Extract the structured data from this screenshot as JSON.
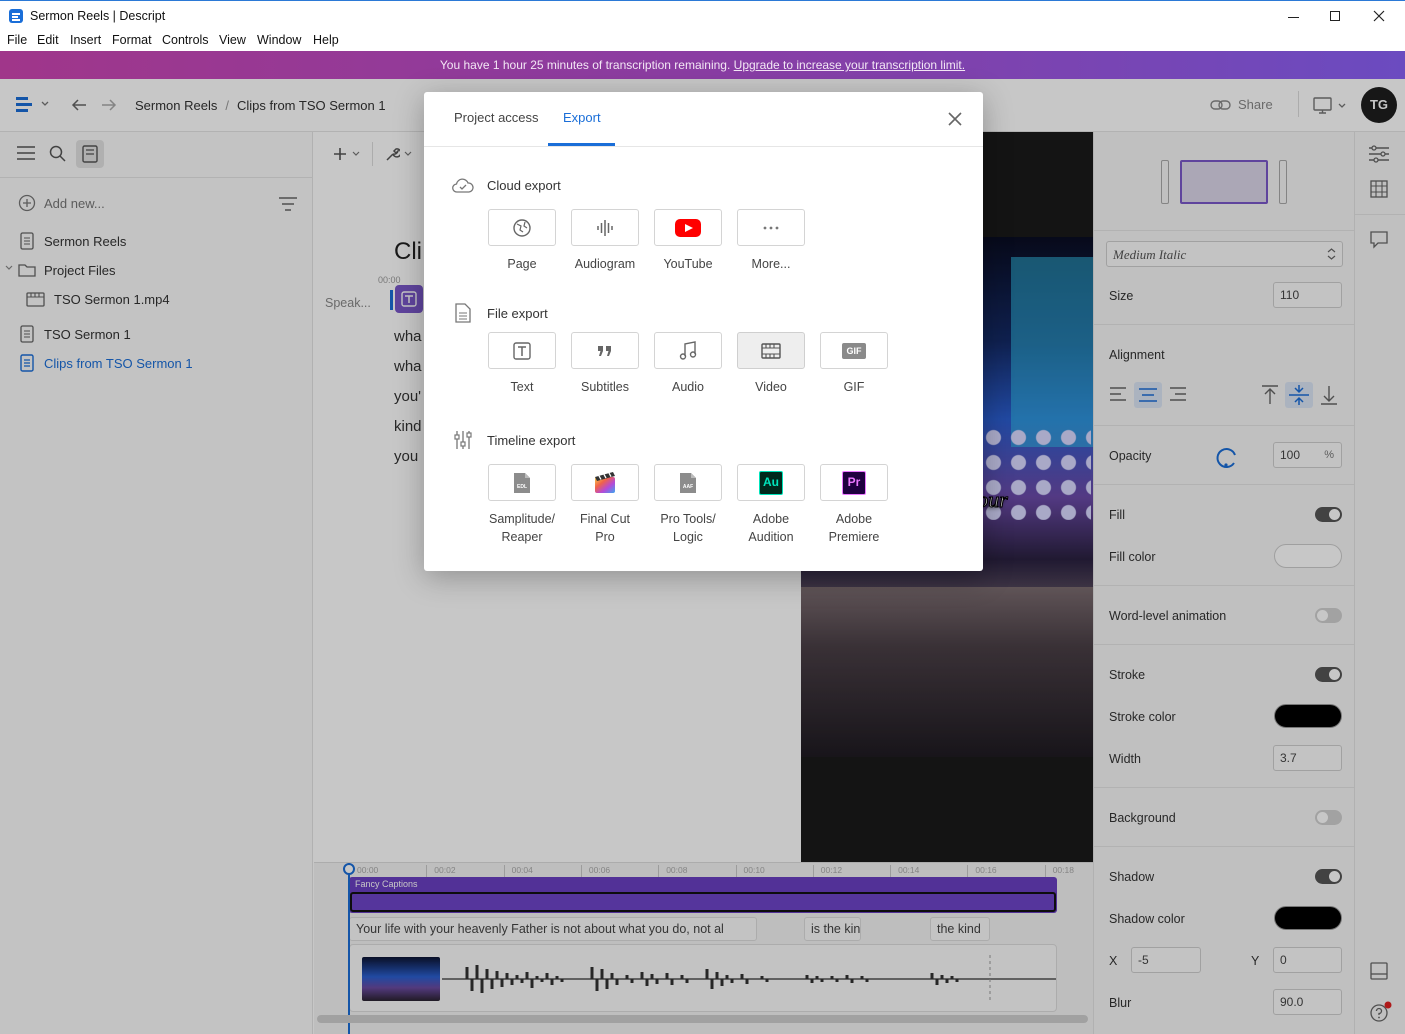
{
  "window": {
    "title": "Sermon Reels | Descript",
    "controls": {
      "minimize": "minimize-icon",
      "maximize": "maximize-icon",
      "close": "close-icon"
    }
  },
  "menu": [
    "File",
    "Edit",
    "Insert",
    "Format",
    "Controls",
    "View",
    "Window",
    "Help"
  ],
  "banner": {
    "text": "You have 1 hour 25 minutes of transcription remaining.",
    "link": "Upgrade to increase your transcription limit."
  },
  "header": {
    "breadcrumb": [
      "Sermon Reels",
      "/",
      "Clips from TSO Sermon 1"
    ],
    "share_label": "Share",
    "avatar_initials": "TG"
  },
  "sidebar": {
    "add_new": "Add new...",
    "items": [
      {
        "label": "Sermon Reels",
        "icon": "document-icon"
      },
      {
        "label": "Project Files",
        "icon": "folder-icon"
      },
      {
        "label": "TSO Sermon 1.mp4",
        "icon": "film-icon"
      },
      {
        "label": "TSO Sermon 1",
        "icon": "document-icon"
      },
      {
        "label": "Clips from TSO Sermon 1",
        "icon": "document-icon",
        "active": true
      }
    ]
  },
  "editor": {
    "title_partial": "Cli",
    "timecode": "00:00",
    "speaker": "Speak...",
    "lines": [
      "wha",
      "wha",
      "you'",
      "kind",
      "you"
    ]
  },
  "video": {
    "caption_partial": "o your"
  },
  "modal": {
    "tabs": [
      "Project access",
      "Export"
    ],
    "active_tab": "Export",
    "sections": [
      {
        "title": "Cloud export",
        "icon": "cloud-check-icon",
        "buttons": [
          {
            "label": "Page",
            "icon": "globe-icon"
          },
          {
            "label": "Audiogram",
            "icon": "waveform-icon"
          },
          {
            "label": "YouTube",
            "icon": "youtube-icon"
          },
          {
            "label": "More...",
            "icon": "more-icon"
          }
        ]
      },
      {
        "title": "File export",
        "icon": "file-icon",
        "buttons": [
          {
            "label": "Text",
            "icon": "text-icon"
          },
          {
            "label": "Subtitles",
            "icon": "quote-icon"
          },
          {
            "label": "Audio",
            "icon": "music-note-icon"
          },
          {
            "label": "Video",
            "icon": "film-icon",
            "selected": true
          },
          {
            "label": "GIF",
            "icon": "gif-icon"
          }
        ]
      },
      {
        "title": "Timeline export",
        "icon": "sliders-icon",
        "buttons": [
          {
            "label": "Samplitude/\nReaper",
            "icon": "edl-file-icon"
          },
          {
            "label": "Final Cut\nPro",
            "icon": "final-cut-icon"
          },
          {
            "label": "Pro Tools/\nLogic",
            "icon": "aaf-file-icon"
          },
          {
            "label": "Adobe\nAudition",
            "icon": "audition-icon"
          },
          {
            "label": "Adobe\nPremiere",
            "icon": "premiere-icon"
          }
        ]
      }
    ]
  },
  "inspector": {
    "font_style": "Medium Italic",
    "size_label": "Size",
    "size_value": "110",
    "alignment_label": "Alignment",
    "opacity_label": "Opacity",
    "opacity_value": "100",
    "opacity_unit": "%",
    "fill_label": "Fill",
    "fill_on": true,
    "fill_color_label": "Fill color",
    "fill_color": "#ffffff",
    "word_anim_label": "Word-level animation",
    "word_anim_on": false,
    "stroke_label": "Stroke",
    "stroke_on": true,
    "stroke_color_label": "Stroke color",
    "stroke_color": "#000000",
    "width_label": "Width",
    "width_value": "3.7",
    "background_label": "Background",
    "background_on": false,
    "shadow_label": "Shadow",
    "shadow_on": true,
    "shadow_color_label": "Shadow color",
    "shadow_color": "#000000",
    "x_label": "X",
    "x_value": "-5",
    "y_label": "Y",
    "y_value": "0",
    "blur_label": "Blur",
    "blur_value": "90.0"
  },
  "timeline": {
    "ticks": [
      "00:00",
      "00:02",
      "00:04",
      "00:06",
      "00:08",
      "00:10",
      "00:12",
      "00:14",
      "00:16",
      "00:18"
    ],
    "caption_track_label": "Fancy Captions",
    "transcript_segments": [
      "Your life with your heavenly Father is not about what you do, not al",
      "is the kin",
      "the kind"
    ]
  },
  "colors": {
    "accent": "#1a6ed8",
    "caption_track": "#6a3fc2",
    "youtube_red": "#ff0000"
  }
}
